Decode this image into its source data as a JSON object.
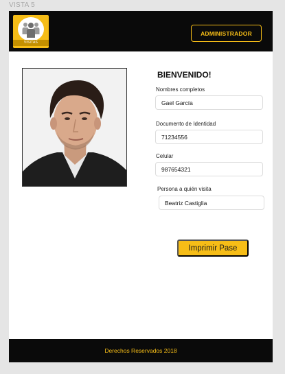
{
  "frame": {
    "label": "VISTA 5"
  },
  "header": {
    "logo_text": "VISITAS",
    "admin_button": "ADMINISTRADOR"
  },
  "welcome": {
    "title": "BIENVENIDO!"
  },
  "form": {
    "fields": [
      {
        "label": "Nombres completos",
        "value": "Gael García"
      },
      {
        "label": "Documento de Identidad",
        "value": "71234556"
      },
      {
        "label": "Celular",
        "value": "987654321"
      },
      {
        "label": "Persona a quién visita",
        "value": "Beatriz Castiglia"
      }
    ]
  },
  "actions": {
    "print_button": "Imprimir Pase"
  },
  "footer": {
    "text": "Derechos Reservados 2018"
  },
  "colors": {
    "accent": "#f6bd17",
    "bar": "#0a0a0a",
    "logo_strip": "#c49000"
  },
  "icons": {
    "logo": "people-group-icon"
  }
}
